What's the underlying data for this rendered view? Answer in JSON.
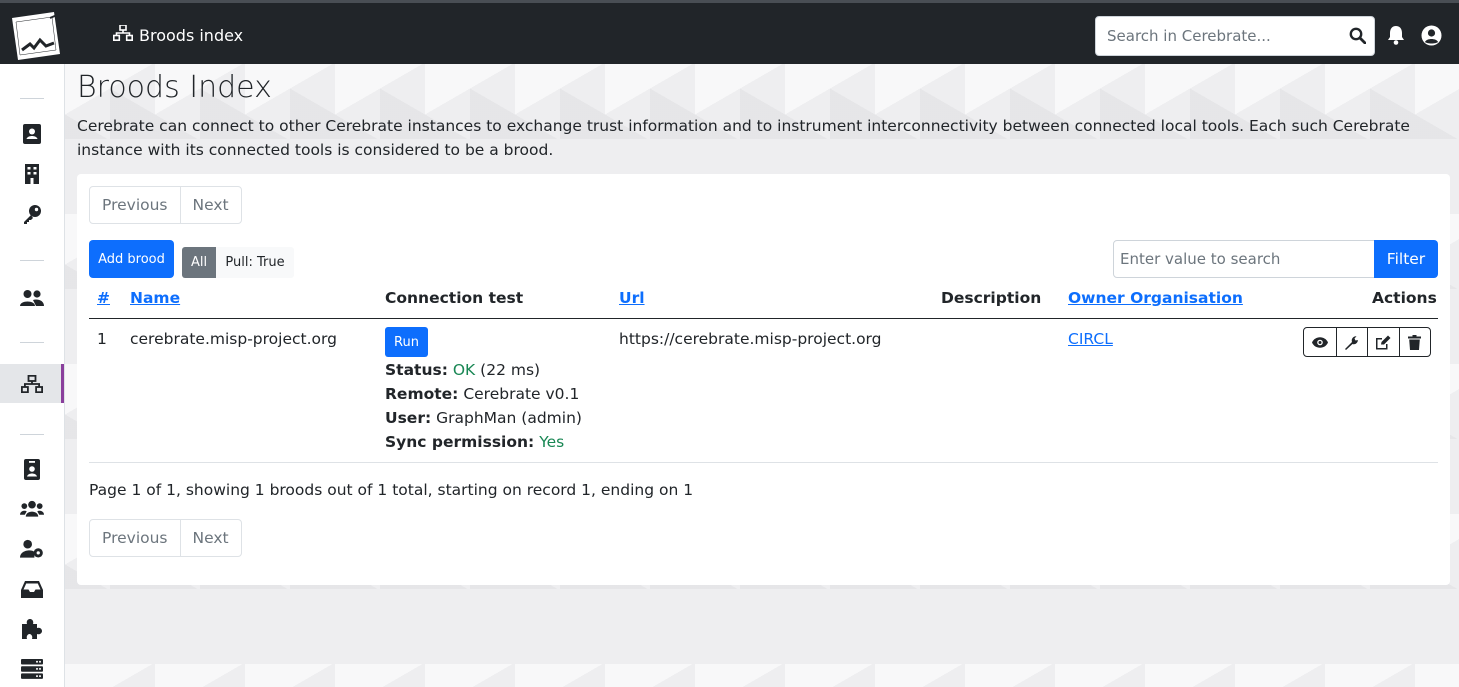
{
  "topbar": {
    "breadcrumb": "Broods index",
    "search_placeholder": "Search in Cerebrate..."
  },
  "page": {
    "title": "Broods Index",
    "description": "Cerebrate can connect to other Cerebrate instances to exchange trust information and to instrument interconnectivity between connected local tools. Each such Cerebrate instance with its connected tools is considered to be a brood."
  },
  "pagination": {
    "previous": "Previous",
    "next": "Next"
  },
  "toolbar": {
    "add_label": "Add brood",
    "filter_all": "All",
    "filter_pull": "Pull: True",
    "search_placeholder": "Enter value to search",
    "filter_label": "Filter"
  },
  "table": {
    "headers": {
      "id": "#",
      "name": "Name",
      "connection": "Connection test",
      "url": "Url",
      "description": "Description",
      "owner": "Owner Organisation",
      "actions": "Actions"
    },
    "rows": [
      {
        "id": "1",
        "name": "cerebrate.misp-project.org",
        "run_label": "Run",
        "status_label": "Status:",
        "status_value": "OK",
        "status_time": "(22 ms)",
        "remote_label": "Remote:",
        "remote_value": "Cerebrate v0.1",
        "user_label": "User:",
        "user_value": "GraphMan (admin)",
        "sync_label": "Sync permission:",
        "sync_value": "Yes",
        "url": "https://cerebrate.misp-project.org",
        "owner": "CIRCL"
      }
    ]
  },
  "footer": {
    "summary": "Page 1 of 1, showing 1 broods out of 1 total, starting on record 1, ending on 1"
  },
  "colors": {
    "primary": "#0d6efd",
    "success": "#198754",
    "topbar": "#212529",
    "active_marker": "#8a3f9c"
  }
}
